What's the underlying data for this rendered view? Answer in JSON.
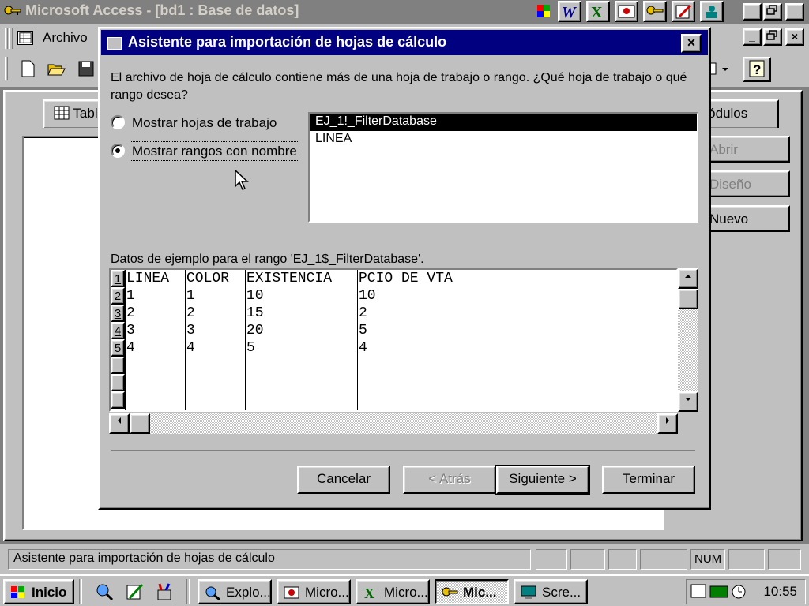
{
  "app": {
    "title": "Microsoft Access - [bd1 : Base de datos]",
    "menu_first": "Archivo",
    "min_btn": "_",
    "max_btn": "å",
    "close_btn": "×"
  },
  "db_window": {
    "tabs": [
      "Tabla",
      "Módulos"
    ],
    "side_buttons": {
      "open": "Abrir",
      "design": "Diseño",
      "new": "Nuevo"
    }
  },
  "dialog": {
    "title": "Asistente para importación de hojas de cálculo",
    "question": "El archivo de hoja de cálculo contiene más de una hoja de trabajo o rango. ¿Qué hoja de trabajo o qué rango desea?",
    "radio_sheets": "Mostrar hojas de trabajo",
    "radio_ranges": "Mostrar rangos con nombre",
    "selected_radio": "ranges",
    "ranges": [
      "EJ_1!_FilterDatabase",
      "LINEA"
    ],
    "selected_range": "EJ_1!_FilterDatabase",
    "sample_label": "Datos de ejemplo para el rango 'EJ_1$_FilterDatabase'.",
    "sample": {
      "row_numbers": [
        "1",
        "2",
        "3",
        "4",
        "5"
      ],
      "columns": [
        "LINEA",
        "COLOR",
        "EXISTENCIA",
        "PCIO DE VTA"
      ],
      "rows": [
        [
          "1",
          "1",
          "10",
          "10"
        ],
        [
          "2",
          "2",
          "15",
          "2"
        ],
        [
          "3",
          "3",
          "20",
          "5"
        ],
        [
          "4",
          "4",
          "5",
          "4"
        ]
      ]
    },
    "buttons": {
      "cancel": "Cancelar",
      "back": "< Atrás",
      "next": "Siguiente >",
      "finish": "Terminar"
    }
  },
  "status": {
    "message": "Asistente para importación de hojas de cálculo",
    "num": "NUM"
  },
  "taskbar": {
    "start": "Inicio",
    "tasks": [
      "Explo...",
      "Micro...",
      "Micro...",
      "Mic...",
      "Scre..."
    ],
    "active_task_index": 3,
    "clock": "10:55"
  },
  "colors": {
    "dialog_title_bg": "#000080",
    "face": "#c0c0c0",
    "inactive_title": "#808080"
  }
}
